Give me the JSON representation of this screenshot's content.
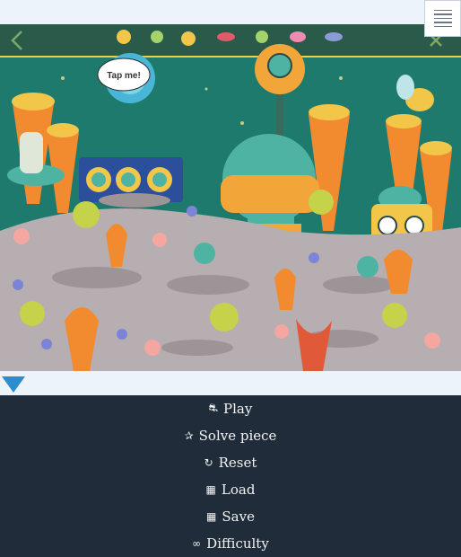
{
  "scene": {
    "bubble_text": "Tap me!",
    "colors": {
      "sky": "#1f7a6e",
      "ground": "#b6aeb0",
      "orange": "#f28a2f",
      "yellow": "#f2c649",
      "teal": "#4fb3a4"
    }
  },
  "menu": {
    "items": [
      {
        "icon": "⛐",
        "icon_name": "piece-icon",
        "label": "Play"
      },
      {
        "icon": "✰",
        "icon_name": "star-icon",
        "label": "Solve piece"
      },
      {
        "icon": "↻",
        "icon_name": "reset-icon",
        "label": "Reset"
      },
      {
        "icon": "▦",
        "icon_name": "load-icon",
        "label": "Load"
      },
      {
        "icon": "▦",
        "icon_name": "save-icon",
        "label": "Save"
      },
      {
        "icon": "∞",
        "icon_name": "infinity-icon",
        "label": "Difficulty"
      }
    ]
  }
}
